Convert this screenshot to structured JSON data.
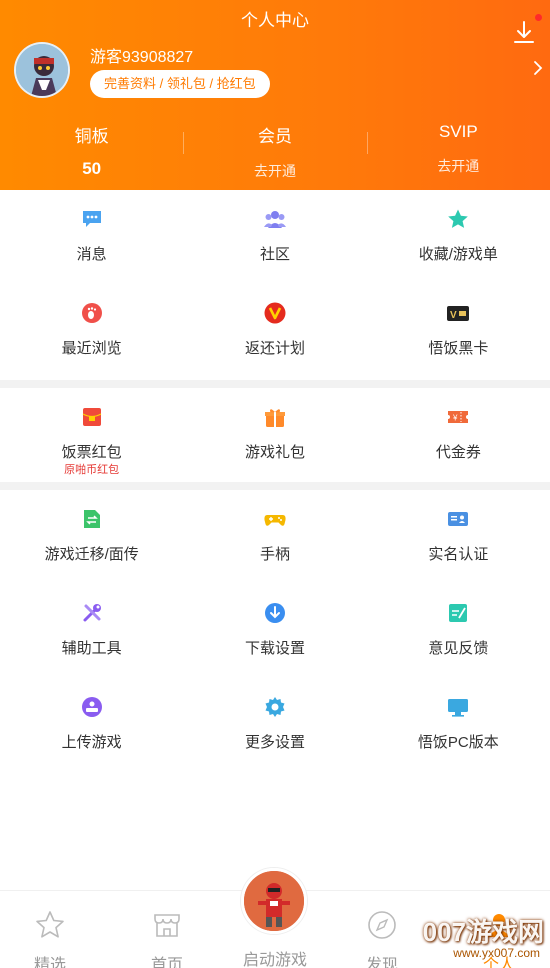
{
  "header": {
    "title": "个人中心",
    "username": "游客93908827",
    "profile_pill": "完善资料 / 领礼包 / 抢红包"
  },
  "stats": [
    {
      "label": "铜板",
      "value": "50"
    },
    {
      "label": "会员",
      "value": "去开通"
    },
    {
      "label": "SVIP",
      "value": "去开通"
    }
  ],
  "section1": [
    {
      "label": "消息",
      "icon": "chat-icon",
      "color": "#4aa3f0"
    },
    {
      "label": "社区",
      "icon": "community-icon",
      "color": "#7f7ff0"
    },
    {
      "label": "收藏/游戏单",
      "icon": "star-icon",
      "color": "#2cc9b0"
    },
    {
      "label": "最近浏览",
      "icon": "footprint-icon",
      "color": "#f0504a"
    },
    {
      "label": "返还计划",
      "icon": "rebate-icon",
      "color": "#e52b1e"
    },
    {
      "label": "悟饭黑卡",
      "icon": "vip-card-icon",
      "color": "#222222"
    }
  ],
  "section2": [
    {
      "label": "饭票红包",
      "sublabel": "原啪币红包",
      "icon": "red-envelope-icon",
      "color": "#f04a3a"
    },
    {
      "label": "游戏礼包",
      "icon": "gift-icon",
      "color": "#ff8a2a"
    },
    {
      "label": "代金券",
      "icon": "coupon-icon",
      "color": "#f06a3a"
    }
  ],
  "section3": [
    {
      "label": "游戏迁移/面传",
      "icon": "transfer-icon",
      "color": "#3cc46a"
    },
    {
      "label": "手柄",
      "icon": "gamepad-icon",
      "color": "#f5b800"
    },
    {
      "label": "实名认证",
      "icon": "id-card-icon",
      "color": "#4a90e2"
    },
    {
      "label": "辅助工具",
      "icon": "tools-icon",
      "color": "#8a5cf0"
    },
    {
      "label": "下载设置",
      "icon": "download-circle-icon",
      "color": "#3a8ef0"
    },
    {
      "label": "意见反馈",
      "icon": "feedback-icon",
      "color": "#2cc9b0"
    },
    {
      "label": "上传游戏",
      "icon": "upload-icon",
      "color": "#8a5cf0"
    },
    {
      "label": "更多设置",
      "icon": "gear-icon",
      "color": "#3aa8e0"
    },
    {
      "label": "悟饭PC版本",
      "icon": "monitor-icon",
      "color": "#3aa8e0"
    }
  ],
  "nav": {
    "items": [
      {
        "label": "精选",
        "icon": "star-outline-icon"
      },
      {
        "label": "首页",
        "icon": "shop-icon"
      },
      {
        "label": "启动游戏",
        "icon": "launch-game-icon"
      },
      {
        "label": "发现",
        "icon": "compass-icon"
      },
      {
        "label": "个人",
        "icon": "person-icon"
      }
    ]
  },
  "watermark": {
    "text": "007游戏网",
    "url": "www.yx007.com"
  },
  "colors": {
    "accent": "#ff7a00",
    "header_start": "#ff8a00",
    "header_end": "#ff6a10"
  }
}
